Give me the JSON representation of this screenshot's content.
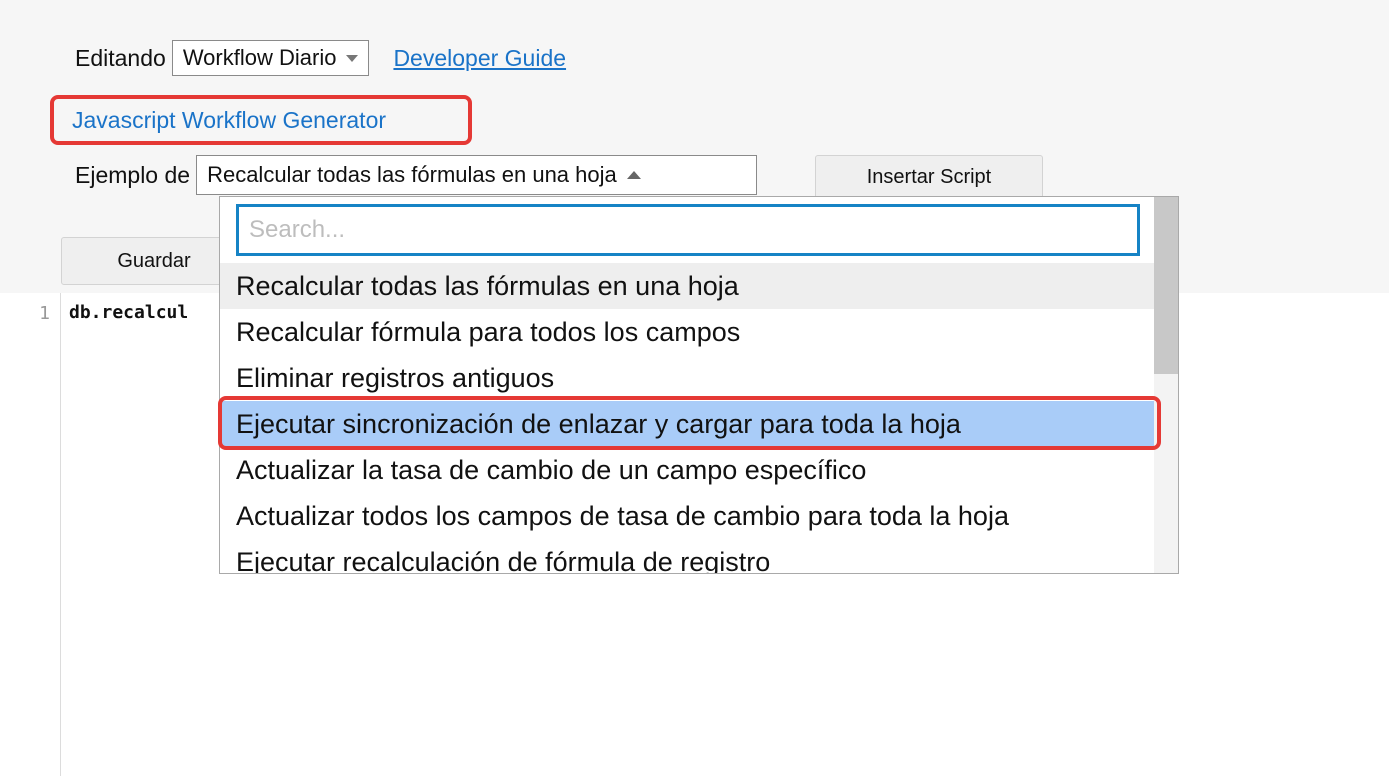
{
  "header": {
    "editing_label": "Editando",
    "workflow_select_value": "Workflow Diario",
    "developer_guide_link": "Developer Guide",
    "generator_link": "Javascript Workflow Generator"
  },
  "example": {
    "label": "Ejemplo de",
    "selected_value": "Recalcular todas las fórmulas en una hoja",
    "insert_button": "Insertar Script"
  },
  "toolbar": {
    "save_button": "Guardar"
  },
  "editor": {
    "line_number": "1",
    "code_line": "db.recalcul"
  },
  "dropdown": {
    "search_placeholder": "Search...",
    "options": [
      "Recalcular todas las fórmulas en una hoja",
      "Recalcular fórmula para todos los campos",
      "Eliminar registros antiguos",
      "Ejecutar sincronización de enlazar y cargar para toda la hoja",
      "Actualizar la tasa de cambio de un campo específico",
      "Actualizar todos los campos de tasa de cambio para toda la hoja",
      "Ejecutar recalculación de fórmula de registro"
    ]
  },
  "colors": {
    "link": "#1a73c8",
    "highlight_border": "#e53935",
    "selected_option": "#a9ccf8",
    "search_border": "#1683c5"
  }
}
